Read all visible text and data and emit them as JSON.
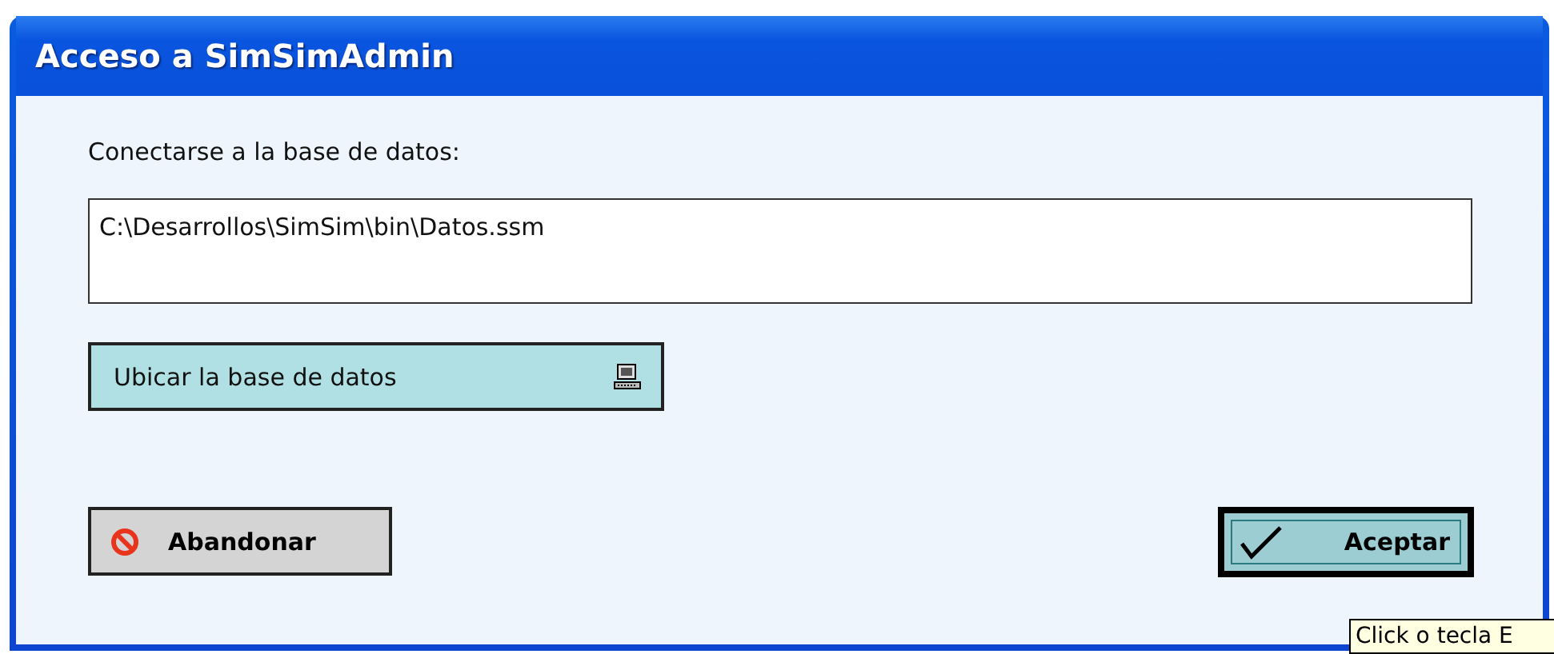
{
  "window": {
    "title": "Acceso a SimSimAdmin"
  },
  "database_label": "Conectarse a la base de datos:",
  "database_path": {
    "value": "C:\\Desarrollos\\SimSim\\bin\\Datos.ssm"
  },
  "buttons": [
    {
      "kind": "locate",
      "label": "Ubicar la base de datos"
    },
    {
      "kind": "cancel",
      "label": "Abandonar"
    },
    {
      "kind": "accept",
      "label": "Aceptar",
      "default": true
    }
  ],
  "tooltip": "Click o tecla E"
}
